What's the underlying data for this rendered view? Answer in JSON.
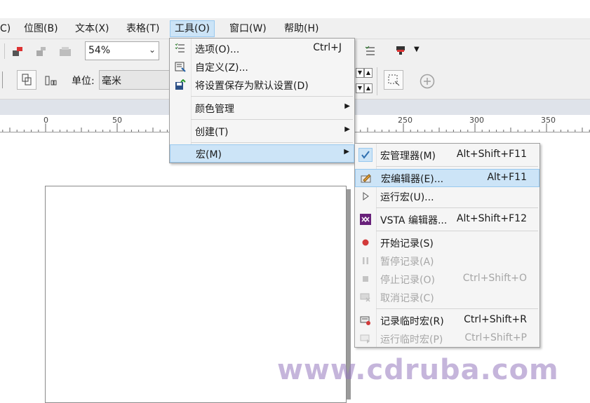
{
  "menubar": {
    "items": [
      {
        "label": "C)"
      },
      {
        "label": "位图(B)"
      },
      {
        "label": "文本(X)"
      },
      {
        "label": "表格(T)"
      },
      {
        "label": "工具(O)"
      },
      {
        "label": "窗口(W)"
      },
      {
        "label": "帮助(H)"
      }
    ]
  },
  "toolbar": {
    "zoom_value": "54%"
  },
  "property_bar": {
    "unit_label": "单位:",
    "unit_value": "毫米"
  },
  "ruler": {
    "labels": [
      "0",
      "50",
      "250",
      "300",
      "350"
    ]
  },
  "tools_menu": {
    "items": [
      {
        "label": "选项(O)...",
        "shortcut": "Ctrl+J"
      },
      {
        "label": "自定义(Z)..."
      },
      {
        "label": "将设置保存为默认设置(D)"
      },
      {
        "label": "颜色管理"
      },
      {
        "label": "创建(T)"
      },
      {
        "label": "宏(M)"
      }
    ]
  },
  "macro_menu": {
    "items": [
      {
        "label": "宏管理器(M)",
        "shortcut": "Alt+Shift+F11"
      },
      {
        "label": "宏编辑器(E)...",
        "shortcut": "Alt+F11"
      },
      {
        "label": "运行宏(U)..."
      },
      {
        "label": "VSTA 编辑器...",
        "shortcut": "Alt+Shift+F12"
      },
      {
        "label": "开始记录(S)"
      },
      {
        "label": "暂停记录(A)"
      },
      {
        "label": "停止记录(O)",
        "shortcut": "Ctrl+Shift+O"
      },
      {
        "label": "取消记录(C)"
      },
      {
        "label": "记录临时宏(R)",
        "shortcut": "Ctrl+Shift+R"
      },
      {
        "label": "运行临时宏(P)",
        "shortcut": "Ctrl+Shift+P"
      }
    ]
  },
  "watermark": "www.cdruba.com",
  "colors": {
    "highlight": "#cce4f7",
    "highlight_border": "#99c9ef",
    "menu_bg": "#f5f5f5",
    "record_red": "#d23a3a",
    "vsta_purple": "#68217a"
  }
}
